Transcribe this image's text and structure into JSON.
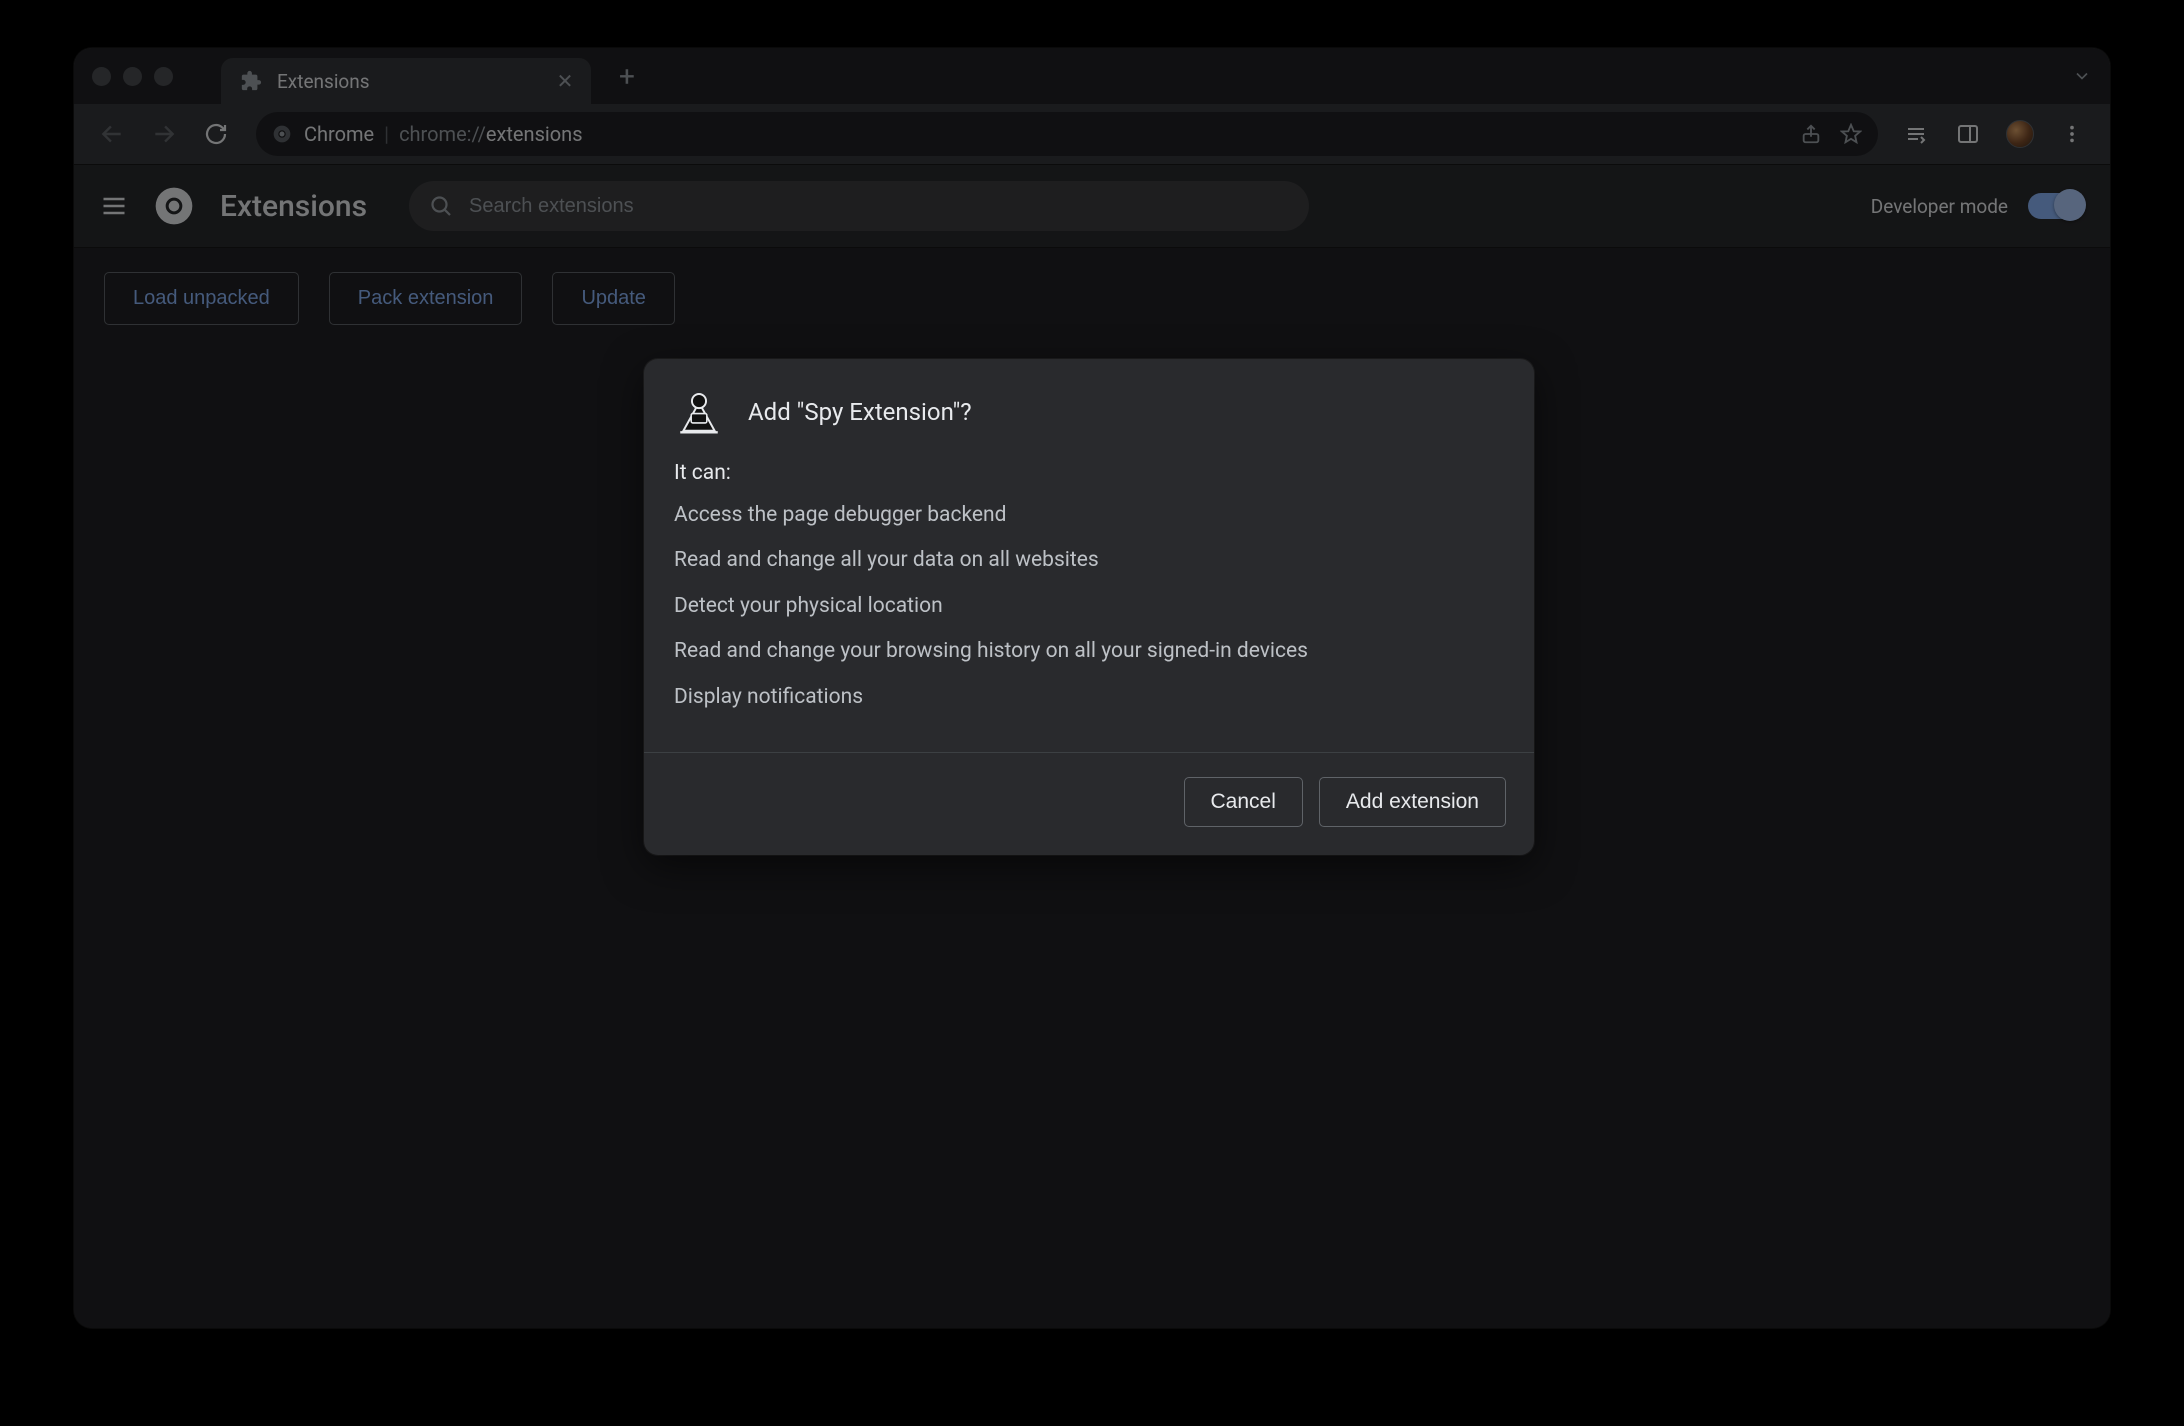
{
  "tab": {
    "title": "Extensions"
  },
  "omnibox": {
    "prefix": "Chrome",
    "scheme": "chrome://",
    "path": "extensions"
  },
  "header": {
    "title": "Extensions",
    "search_placeholder": "Search extensions",
    "dev_mode_label": "Developer mode",
    "dev_mode_on": true
  },
  "actions": {
    "load_unpacked": "Load unpacked",
    "pack_extension": "Pack extension",
    "update": "Update"
  },
  "dialog": {
    "title": "Add \"Spy Extension\"?",
    "lead": "It can:",
    "permissions": [
      "Access the page debugger backend",
      "Read and change all your data on all websites",
      "Detect your physical location",
      "Read and change your browsing history on all your signed-in devices",
      "Display notifications"
    ],
    "cancel": "Cancel",
    "confirm": "Add extension"
  }
}
